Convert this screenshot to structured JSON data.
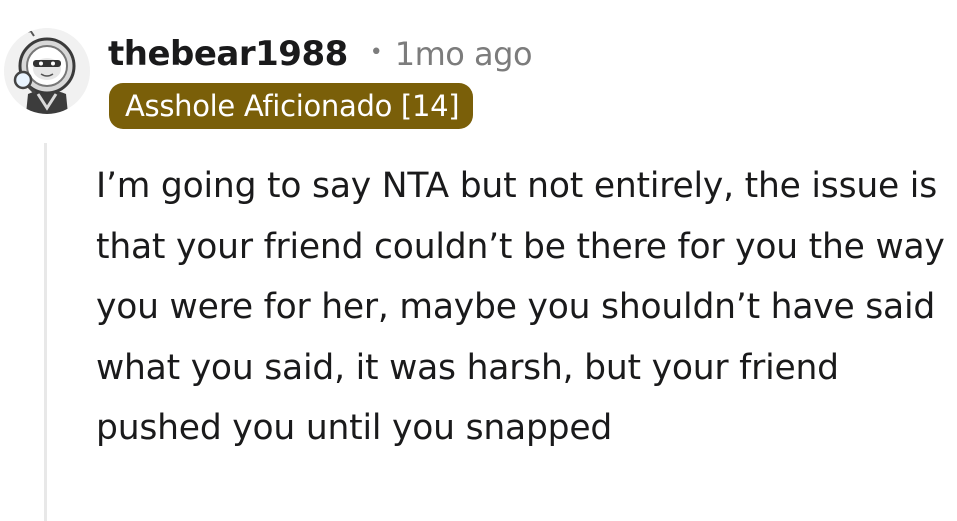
{
  "comment": {
    "username": "thebear1988",
    "separator": "•",
    "timestamp": "1mo ago",
    "flair": "Asshole Aficionado [14]",
    "body": "I’m going to say NTA but not entirely, the issue is that your friend couldn’t be there for you the way you were for her, maybe you shouldn’t have said what you said, it was harsh, but your friend pushed you until you snapped"
  },
  "avatar": {
    "icon": "reddit-snoo-astronaut-avatar"
  },
  "colors": {
    "flair_background": "#7a5f09",
    "flair_text": "#ffffff",
    "meta_text": "#7c7c7c",
    "body_text": "#1a1a1b",
    "thread_line": "#e8e8e8"
  }
}
